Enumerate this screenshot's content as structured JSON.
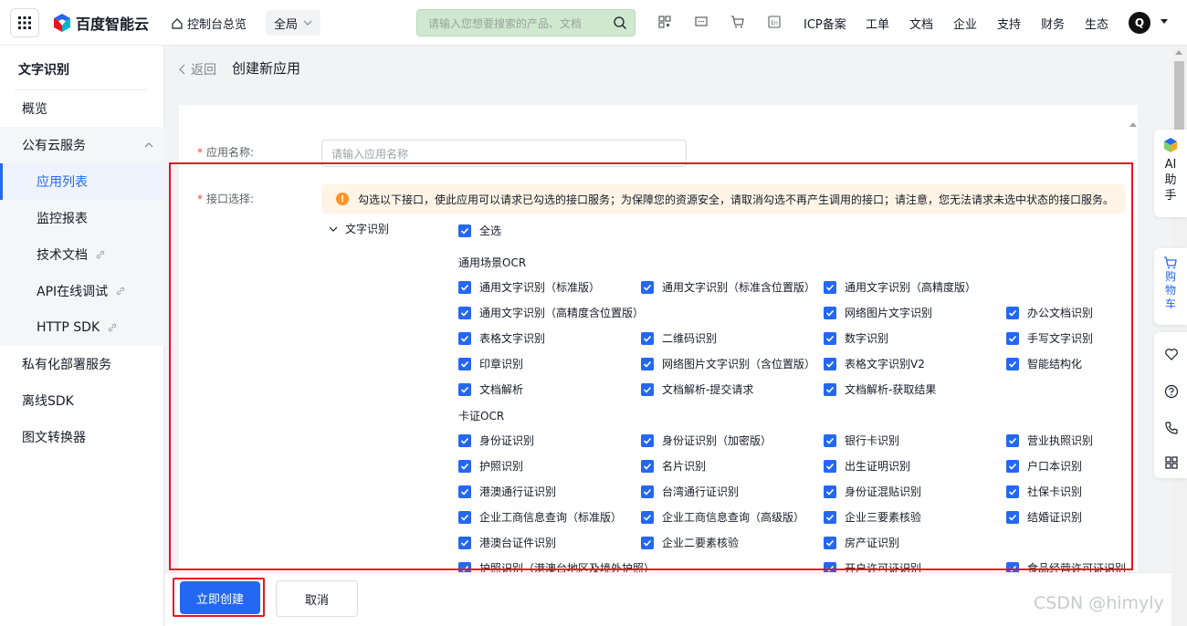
{
  "topbar": {
    "logo_text": "百度智能云",
    "console_label": "控制台总览",
    "scope_label": "全局",
    "search_placeholder": "请输入您想要搜索的产品、文档",
    "nav": [
      "ICP备案",
      "工单",
      "文档",
      "企业",
      "支持",
      "财务",
      "生态"
    ],
    "avatar_initial": "Q"
  },
  "sidebar": {
    "title": "文字识别",
    "items": [
      {
        "label": "概览"
      },
      {
        "label": "公有云服务"
      },
      {
        "label": "应用列表"
      },
      {
        "label": "监控报表"
      },
      {
        "label": "技术文档"
      },
      {
        "label": "API在线调试"
      },
      {
        "label": "HTTP SDK"
      },
      {
        "label": "私有化部署服务"
      },
      {
        "label": "离线SDK"
      },
      {
        "label": "图文转换器"
      }
    ]
  },
  "header": {
    "back_label": "返回",
    "title": "创建新应用"
  },
  "form": {
    "name_label": "应用名称:",
    "name_placeholder": "请输入应用名称",
    "api_label": "接口选择:",
    "notice": "勾选以下接口，使此应用可以请求已勾选的接口服务；为保障您的资源安全，请取消勾选不再产生调用的接口；请注意，您无法请求未选中状态的接口服务。",
    "tree_label": "文字识别",
    "select_all": "全选",
    "group1": "通用场景OCR",
    "group2": "卡证OCR",
    "apis": [
      "通用文字识别（标准版）",
      "通用文字识别（标准含位置版）",
      "通用文字识别（高精度版）",
      "通用文字识别（高精度含位置版）",
      "网络图片文字识别",
      "办公文档识别",
      "表格文字识别",
      "二维码识别",
      "数字识别",
      "手写文字识别",
      "印章识别",
      "网络图片文字识别（含位置版）",
      "表格文字识别V2",
      "智能结构化",
      "文档解析",
      "文档解析-提交请求",
      "文档解析-获取结果",
      "身份证识别",
      "身份证识别（加密版）",
      "银行卡识别",
      "营业执照识别",
      "护照识别",
      "名片识别",
      "出生证明识别",
      "户口本识别",
      "港澳通行证识别",
      "台湾通行证识别",
      "身份证混贴识别",
      "社保卡识别",
      "企业工商信息查询（标准版）",
      "企业工商信息查询（高级版）",
      "企业三要素核验",
      "结婚证识别",
      "港澳台证件识别",
      "企业二要素核验",
      "房产证识别",
      "护照识别（港澳台地区及境外护照）",
      "开户许可证识别",
      "食品经营许可证识别"
    ]
  },
  "footer": {
    "create_label": "立即创建",
    "cancel_label": "取消"
  },
  "float": {
    "ai_label": "AI助手",
    "cart_label": "购物车"
  },
  "watermark": "CSDN @himyly",
  "colors": {
    "accent": "#2468f2",
    "highlight_frame": "#e8141e",
    "notice_bg": "#fff4e6"
  }
}
